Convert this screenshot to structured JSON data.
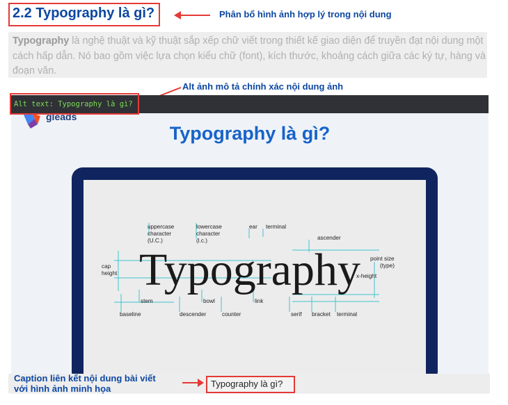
{
  "heading": {
    "text": "2.2 Typography là gì?"
  },
  "annotations": {
    "top": "Phân bổ hình ảnh hợp lý trong nội dung",
    "alt": "Alt ảnh mô tả chính xác nội dung ảnh",
    "caption_line1": "Caption liên kết nội dung bài viết",
    "caption_line2": "với hình ảnh minh họa"
  },
  "intro": {
    "bold_word": "Typography",
    "text": " là nghệ thuật và kỹ thuật sắp xếp chữ viết trong thiết kế giao diện để truyền đạt nội dung một cách hấp dẫn. Nó bao gồm việc lựa chọn kiểu chữ (font), kích thước, khoảng cách giữa các ký tự, hàng và đoạn văn."
  },
  "alt_bar": {
    "text": "Alt text: Typography là gì?"
  },
  "image": {
    "logo_text": "gleads",
    "title": "Typography là gì?",
    "word": "Typography",
    "labels": {
      "uppercase": [
        "uppercase",
        "character",
        "(U.C.)"
      ],
      "lowercase": [
        "lowercase",
        "character",
        "(l.c.)"
      ],
      "ear": "ear",
      "terminal_top": "terminal",
      "ascender": "ascender",
      "point_size": [
        "point size",
        "(type)"
      ],
      "cap_height": [
        "cap",
        "height"
      ],
      "x_height": "x-height",
      "stem": "stem",
      "bowl": "bowl",
      "link": "link",
      "baseline": "baseline",
      "descender": "descender",
      "counter": "counter",
      "serif": "serif",
      "bracket": "bracket",
      "terminal_bottom": "terminal"
    }
  },
  "caption": {
    "text": "Typography là gì?"
  },
  "colors": {
    "accent_red": "#e53935",
    "heading_blue": "#0d47a1",
    "laptop_navy": "#10255f",
    "alt_green": "#7ed957"
  }
}
